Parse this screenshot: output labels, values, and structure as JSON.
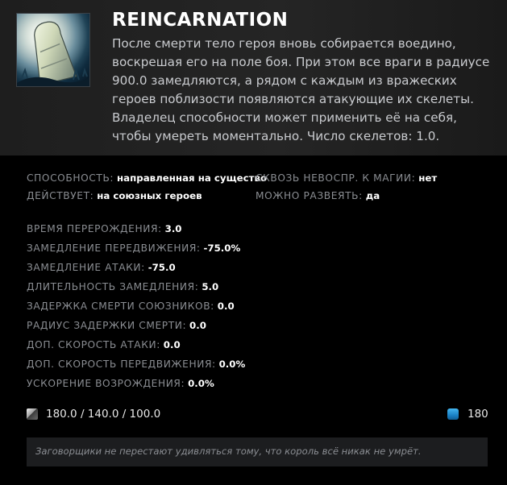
{
  "ability": {
    "title": "REINCARNATION",
    "icon": "reincarnation-tombstone-icon",
    "description": "После смерти тело героя вновь собирается воедино, воскрешая его на поле боя. При этом все враги в радиусе 900.0 замедляются, а рядом с каждым из вражеских героев поблизости появляются атакующие их скелеты. Владелец способности может применить её на себя, чтобы умереть моментально. Число скелетов: 1.0."
  },
  "properties": {
    "ability": {
      "label": "СПОСОБНОСТЬ:",
      "value": "направленная на существо"
    },
    "pierces": {
      "label": "СКВОЗЬ НЕВОСПР. К МАГИИ:",
      "value": "нет"
    },
    "affects": {
      "label": "ДЕЙСТВУЕТ:",
      "value": "на союзных героев"
    },
    "dispellable": {
      "label": "МОЖНО РАЗВЕЯТЬ:",
      "value": "да"
    }
  },
  "stats": [
    {
      "label": "ВРЕМЯ ПЕРЕРОЖДЕНИЯ:",
      "value": "3.0"
    },
    {
      "label": "ЗАМЕДЛЕНИЕ ПЕРЕДВИЖЕНИЯ:",
      "value": "-75.0%"
    },
    {
      "label": "ЗАМЕДЛЕНИЕ АТАКИ:",
      "value": "-75.0"
    },
    {
      "label": "ДЛИТЕЛЬНОСТЬ ЗАМЕДЛЕНИЯ:",
      "value": "5.0"
    },
    {
      "label": "ЗАДЕРЖКА СМЕРТИ СОЮЗНИКОВ:",
      "value": "0.0"
    },
    {
      "label": "РАДИУС ЗАДЕРЖКИ СМЕРТИ:",
      "value": "0.0"
    },
    {
      "label": "ДОП. СКОРОСТЬ АТАКИ:",
      "value": "0.0"
    },
    {
      "label": "ДОП. СКОРОСТЬ ПЕРЕДВИЖЕНИЯ:",
      "value": "0.0%"
    },
    {
      "label": "УСКОРЕНИЕ ВОЗРОЖДЕНИЯ:",
      "value": "0.0%"
    }
  ],
  "cooldown": {
    "icon": "cooldown-icon",
    "value": "180.0 / 140.0 / 100.0"
  },
  "mana": {
    "icon": "mana-icon",
    "value": "180",
    "color": "#1b82c7"
  },
  "lore": "Заговорщики не перестают удивляться тому, что король всё никак не умрёт."
}
